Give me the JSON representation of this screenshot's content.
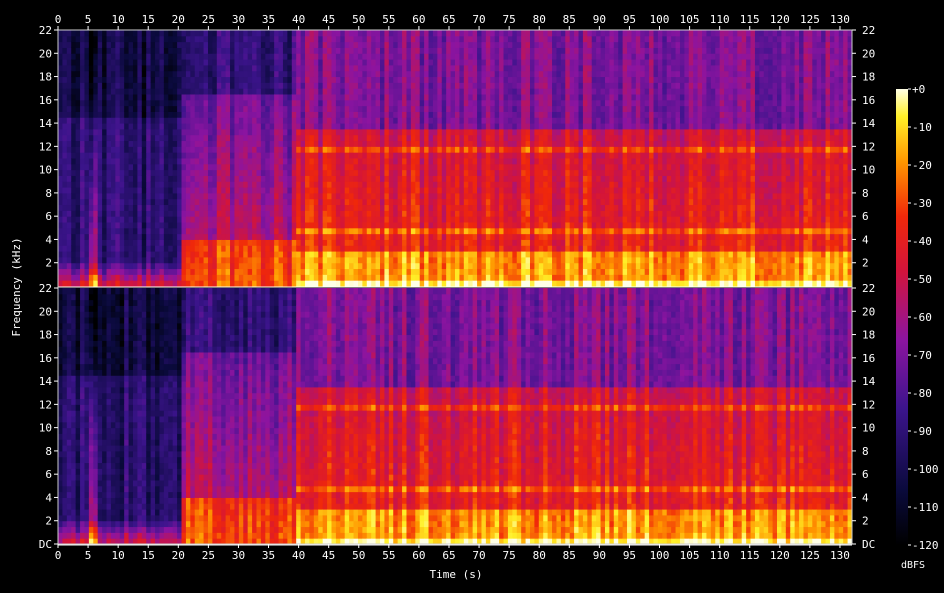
{
  "chart_data": {
    "type": "heatmap",
    "title": "",
    "xlabel": "Time (s)",
    "ylabel": "Frequency (kHz)",
    "colorbar_label": "dBFS",
    "xlim": [
      0,
      132
    ],
    "ylim": [
      0,
      22
    ],
    "x_ticks": [
      "0",
      "5",
      "10",
      "15",
      "20",
      "25",
      "30",
      "35",
      "40",
      "45",
      "50",
      "55",
      "60",
      "65",
      "70",
      "75",
      "80",
      "85",
      "90",
      "95",
      "100",
      "105",
      "110",
      "115",
      "120",
      "125",
      "130"
    ],
    "y_ticks": [
      "DC",
      "2",
      "4",
      "6",
      "8",
      "10",
      "12",
      "14",
      "16",
      "18",
      "20",
      "22"
    ],
    "colorbar_range": [
      -120,
      0
    ],
    "colorbar_ticks": [
      "+0",
      "-10",
      "-20",
      "-30",
      "-40",
      "-50",
      "-60",
      "-70",
      "-80",
      "-90",
      "-100",
      "-110",
      "-120"
    ],
    "channels": [
      {
        "name": "",
        "segments": [
          {
            "t": [
              0,
              20
            ],
            "level": "quiet",
            "spike_t": 5.3
          },
          {
            "t": [
              20,
              39
            ],
            "level": "medium"
          },
          {
            "t": [
              39,
              132
            ],
            "level": "loud",
            "tone_khz": [
              11.5,
              4.8,
              0.4
            ]
          }
        ]
      },
      {
        "name": "",
        "segments": [
          {
            "t": [
              0,
              20
            ],
            "level": "quiet",
            "spike_t": 5.3
          },
          {
            "t": [
              20,
              39
            ],
            "level": "medium"
          },
          {
            "t": [
              39,
              132
            ],
            "level": "loud",
            "tone_khz": [
              11.5,
              4.8,
              0.4
            ]
          }
        ]
      }
    ]
  }
}
